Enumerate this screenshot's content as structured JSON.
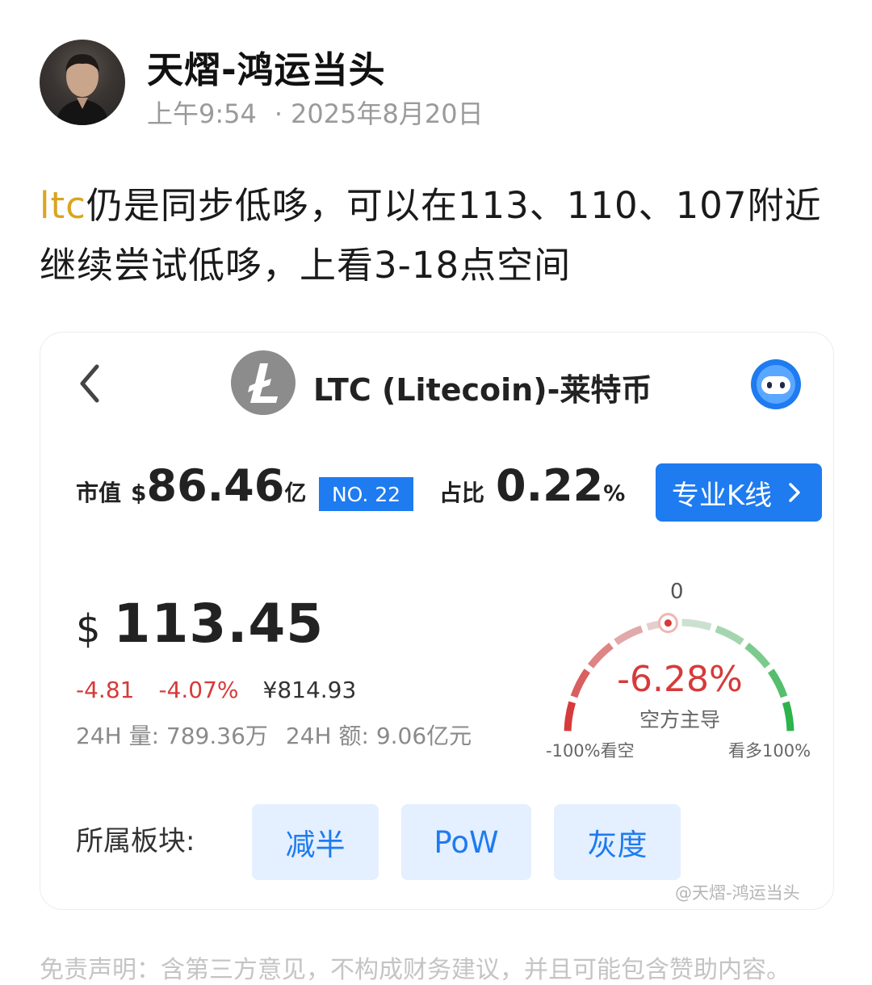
{
  "post": {
    "author": "天熠-鸿运当头",
    "time": "上午9:54",
    "date": "2025年8月20日",
    "date_sep": "·",
    "text_tag": "ltc",
    "text_body": "仍是同步低哆，可以在113、110、107附近继续尝试低哆，上看3-18点空间"
  },
  "card": {
    "title": "LTC (Litecoin)-莱特币",
    "market_cap_label": "市值",
    "market_cap_currency": "$",
    "market_cap_value": "86.46",
    "market_cap_unit": "亿",
    "rank": "NO. 22",
    "share_label": "占比",
    "share_value": "0.22",
    "share_unit": "%",
    "kline_button": "专业K线",
    "price_currency": "$",
    "price": "113.45",
    "change_abs": "-4.81",
    "change_pct": "-4.07%",
    "price_cny": "¥814.93",
    "volume_label": "24H 量: 789.36万",
    "turnover_label": "24H 额: 9.06亿元",
    "gauge": {
      "zero_label": "0",
      "value_text": "-6.28%",
      "sentiment": "空方主导",
      "left_label": "-100%看空",
      "right_label": "看多100%",
      "level": -0.0628
    },
    "sector_label": "所属板块:",
    "sectors": [
      "减半",
      "PoW",
      "灰度"
    ],
    "watermark": "@天熠-鸿运当头"
  },
  "disclaimer": "免责声明：含第三方意见，不构成财务建议，并且可能包含赞助内容。",
  "icons": {
    "back": "chevron-left-icon",
    "coin": "litecoin-logo-icon",
    "assistant": "robot-assistant-icon",
    "kline_arrow": "chevron-right-icon"
  },
  "colors": {
    "accent": "#1e7bf0",
    "negative": "#d63a3a",
    "positive": "#2db34a",
    "tag": "#d9a520"
  }
}
